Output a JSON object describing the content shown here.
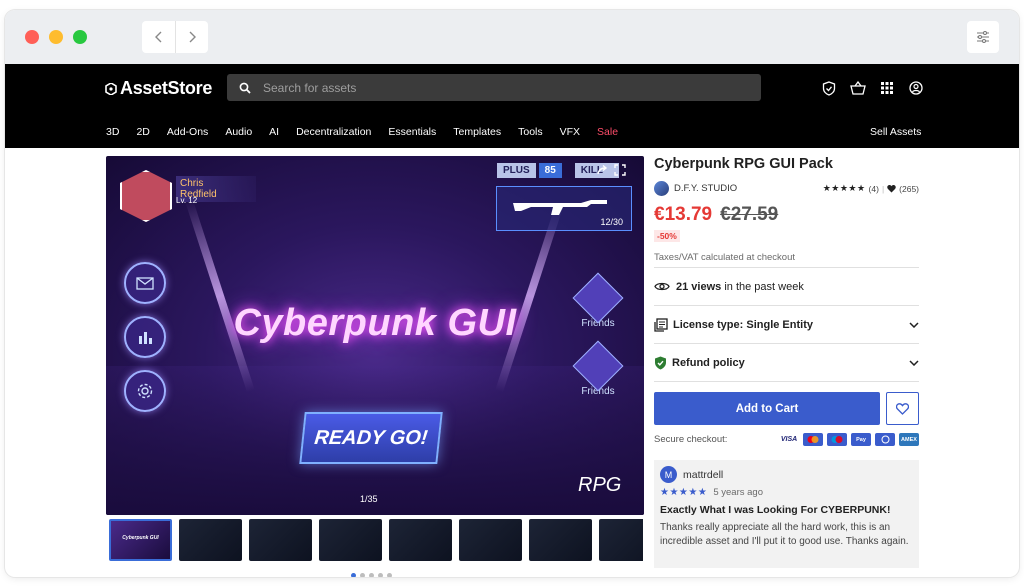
{
  "browser": {
    "back_icon": "chevron-left-icon",
    "forward_icon": "chevron-right-icon",
    "settings_icon": "sliders-icon"
  },
  "header": {
    "logo": "AssetStore",
    "search_placeholder": "Search for assets",
    "icons": [
      "shield-check-icon",
      "cart-icon",
      "grid-icon",
      "account-icon"
    ],
    "categories": [
      "3D",
      "2D",
      "Add-Ons",
      "Audio",
      "AI",
      "Decentralization",
      "Essentials",
      "Templates",
      "Tools",
      "VFX",
      "Sale"
    ],
    "sell_assets": "Sell Assets"
  },
  "hero": {
    "player_name": "Chris Redfield",
    "player_level": "Lv. 12",
    "plus_label": "PLUS",
    "plus_value": "85",
    "kill_label": "KILL",
    "ammo": "12/30",
    "title": "Cyberpunk GUI",
    "ready_button": "READY GO!",
    "friends_label": "Friends",
    "rpg_label": "RPG",
    "slide_counter": "1/35",
    "thumbnail_count": 8,
    "thumbnail_label": "Cyberpunk GUI"
  },
  "product": {
    "title": "Cyberpunk RPG GUI Pack",
    "publisher": "D.F.Y. STUDIO",
    "stars": "★★★★★",
    "rating_count": "(4)",
    "favorites": "(265)",
    "price_now": "€13.79",
    "price_old": "€27.59",
    "discount": "-50%",
    "tax_note": "Taxes/VAT calculated at checkout",
    "views_count": "21 views",
    "views_suffix": "in the past week",
    "license": "License type: Single Entity",
    "refund": "Refund policy",
    "add_to_cart": "Add to Cart",
    "secure_checkout": "Secure checkout:",
    "payment_methods": [
      "VISA",
      "mastercard",
      "maestro",
      "PayPal",
      "Diners",
      "AMEX"
    ]
  },
  "review": {
    "avatar_letter": "M",
    "user": "mattrdell",
    "stars": "★★★★★",
    "time": "5 years ago",
    "title": "Exactly What I was Looking For CYBERPUNK!",
    "body": "Thanks really appreciate all the hard work, this is an incredible asset and I'll put it to good use. Thanks again."
  },
  "colors": {
    "accent": "#3a5ccc",
    "price": "#e53935",
    "header_bg": "#000000"
  }
}
